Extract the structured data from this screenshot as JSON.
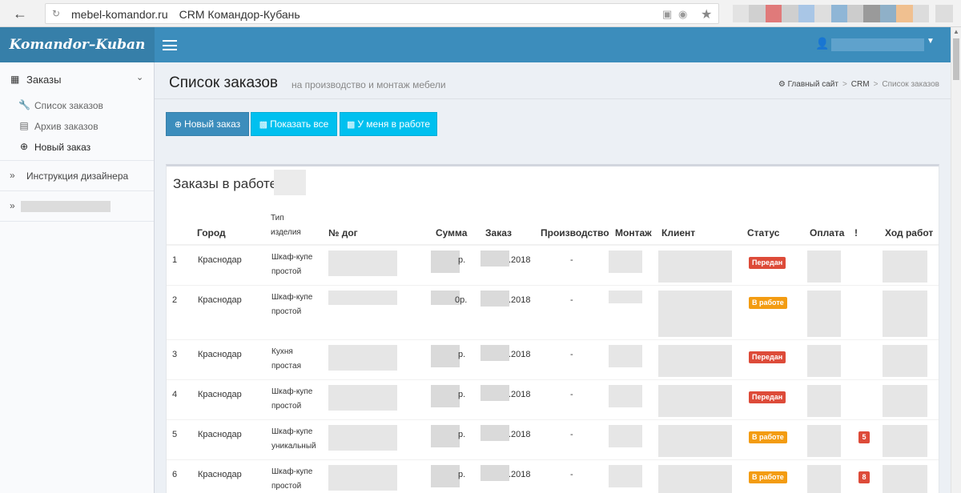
{
  "browser": {
    "url": "mebel-komandor.ru",
    "tab_title": "CRM Командор-Кубань",
    "extension_colors": [
      "#e3e3e3",
      "#d0d0d0",
      "#e07a7a",
      "#cfcfcf",
      "#a9c6e6",
      "#dedede",
      "#8fb6d6",
      "#cccccc",
      "#9a9a9a",
      "#8fb0c8",
      "#f0c090",
      "#dcdcdc"
    ]
  },
  "header": {
    "logo": "Komandor–Kuban"
  },
  "sidebar": {
    "section_label": "Заказы",
    "sub_items": [
      {
        "label": "Список заказов",
        "icon": "wrench-icon"
      },
      {
        "label": "Архив заказов",
        "icon": "archive-icon"
      },
      {
        "label": "Новый заказ",
        "icon": "plus-circle-icon"
      }
    ],
    "designer_guide": "Инструкция дизайнера"
  },
  "page": {
    "title": "Список заказов",
    "subtitle": "на производство и монтаж мебели",
    "breadcrumb": {
      "home": "Главный сайт",
      "crm": "CRM",
      "current": "Список заказов"
    }
  },
  "toolbar": {
    "new_order": "Новый заказ",
    "show_all": "Показать все",
    "my_work": "У меня в работе"
  },
  "orders": {
    "box_title": "Заказы в работе",
    "columns": {
      "city": "Город",
      "type_line1": "Тип",
      "type_line2": "изделия",
      "contract": "№ дог",
      "sum": "Сумма",
      "order": "Заказ",
      "production": "Производство",
      "install": "Монтаж",
      "client": "Клиент",
      "status": "Статус",
      "payment": "Оплата",
      "flag": "!",
      "progress": "Ход работ"
    },
    "rows": [
      {
        "n": "1",
        "city": "Краснодар",
        "type1": "Шкаф-купе",
        "type2": "простой",
        "sum_suffix": "р.",
        "order_date": ".2018",
        "production": "-",
        "status": "Передан",
        "status_color": "#dd4b39",
        "flag": ""
      },
      {
        "n": "2",
        "city": "Краснодар",
        "type1": "Шкаф-купе",
        "type2": "простой",
        "sum_suffix": "0р.",
        "order_date": ".2018",
        "production": "-",
        "status": "В работе",
        "status_color": "#f39c12",
        "flag": ""
      },
      {
        "n": "3",
        "city": "Краснодар",
        "type1": "Кухня",
        "type2": "простая",
        "sum_suffix": "р.",
        "order_date": ".2018",
        "production": "-",
        "status": "Передан",
        "status_color": "#dd4b39",
        "flag": ""
      },
      {
        "n": "4",
        "city": "Краснодар",
        "type1": "Шкаф-купе",
        "type2": "простой",
        "sum_suffix": "р.",
        "order_date": ".2018",
        "production": "-",
        "status": "Передан",
        "status_color": "#dd4b39",
        "flag": ""
      },
      {
        "n": "5",
        "city": "Краснодар",
        "type1": "Шкаф-купе",
        "type2": "уникальный",
        "sum_suffix": "р.",
        "order_date": ".2018",
        "production": "-",
        "status": "В работе",
        "status_color": "#f39c12",
        "flag": "5"
      },
      {
        "n": "6",
        "city": "Краснодар",
        "type1": "Шкаф-купе",
        "type2": "простой",
        "sum_suffix": "р.",
        "order_date": ".2018",
        "production": "-",
        "status": "В работе",
        "status_color": "#f39c12",
        "flag": "8"
      }
    ]
  }
}
